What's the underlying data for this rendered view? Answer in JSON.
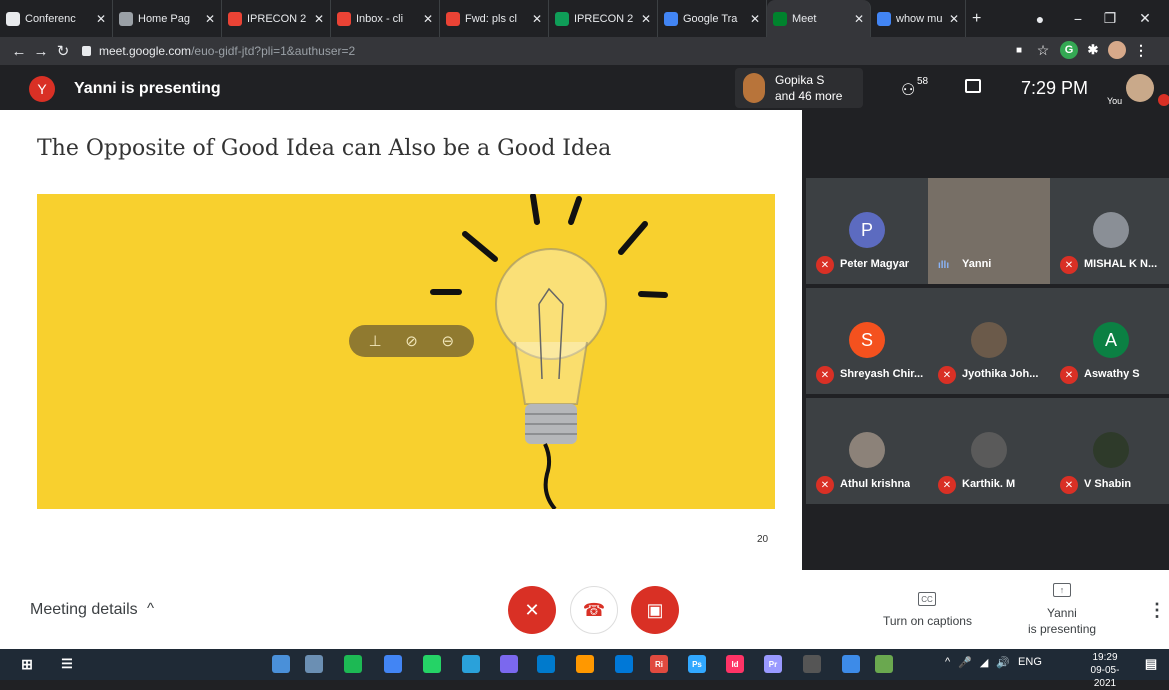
{
  "browser": {
    "tabs": [
      {
        "label": "Conferenc",
        "fav": "globe-icon",
        "color": "#e8eaed"
      },
      {
        "label": "Home Pag",
        "fav": "globe-icon",
        "color": "#9aa0a6"
      },
      {
        "label": "IPRECON 2",
        "fav": "gmail-icon",
        "color": "#ea4335"
      },
      {
        "label": "Inbox - cli",
        "fav": "gmail-icon",
        "color": "#ea4335"
      },
      {
        "label": "Fwd: pls cl",
        "fav": "gmail-icon",
        "color": "#ea4335"
      },
      {
        "label": "IPRECON 2",
        "fav": "sheets-icon",
        "color": "#0f9d58"
      },
      {
        "label": "Google Tra",
        "fav": "slides-icon",
        "color": "#4285f4"
      },
      {
        "label": "Meet",
        "fav": "meet-icon",
        "color": "#00832d"
      },
      {
        "label": "whow muc",
        "fav": "google-icon",
        "color": "#4285f4"
      }
    ],
    "new_tab": "+",
    "url_domain": "meet.google.com",
    "url_path": "/euo-gidf-jtd?pli=1&authuser=2"
  },
  "meet": {
    "presenter_initial": "Y",
    "presenting_text": "Yanni is presenting",
    "people_chip_line1": "Gopika S",
    "people_chip_line2": "and 46 more",
    "participant_count": "58",
    "time": "7:29 PM",
    "you_label": "You"
  },
  "slide": {
    "title": "The Opposite of Good Idea can Also be a Good Idea",
    "page_number": "20"
  },
  "participants": [
    {
      "name": "Peter Magyar",
      "initial": "P",
      "color": "#5c6bc0",
      "muted": true,
      "photo": false
    },
    {
      "name": "Yanni",
      "initial": "",
      "color": "#776f66",
      "muted": false,
      "photo": true,
      "speaking": true
    },
    {
      "name": "MISHAL K N...",
      "initial": "",
      "color": "#8a8f96",
      "muted": true,
      "photo": true
    },
    {
      "name": "Shreyash Chir...",
      "initial": "S",
      "color": "#f4511e",
      "muted": true,
      "photo": false
    },
    {
      "name": "Jyothika Joh...",
      "initial": "",
      "color": "#6b5a4a",
      "muted": true,
      "photo": true
    },
    {
      "name": "Aswathy S",
      "initial": "A",
      "color": "#0b8043",
      "muted": true,
      "photo": false
    },
    {
      "name": "Athul krishna",
      "initial": "",
      "color": "#8c8279",
      "muted": true,
      "photo": true
    },
    {
      "name": "Karthik. M",
      "initial": "",
      "color": "#5a5a5a",
      "muted": true,
      "photo": true
    },
    {
      "name": "V Shabin",
      "initial": "",
      "color": "#2e3a2a",
      "muted": true,
      "photo": true
    }
  ],
  "bottom": {
    "meeting_details": "Meeting details",
    "captions_label": "Turn on captions",
    "presenting_l1": "Yanni",
    "presenting_l2": "is presenting"
  },
  "taskbar": {
    "lang": "ENG",
    "time": "19:29",
    "date": "09-05-2021"
  }
}
